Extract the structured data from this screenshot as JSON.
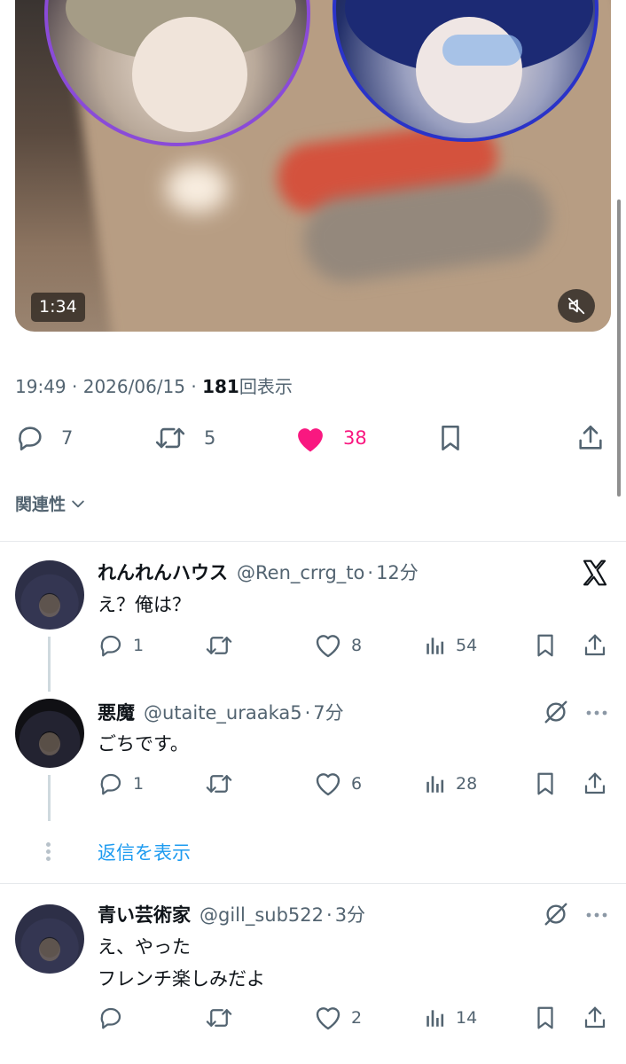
{
  "video": {
    "timecode": "1:34",
    "mute_icon": "sound-off-icon"
  },
  "post": {
    "time": "19:49",
    "separator1": " · ",
    "date": "2026/06/15",
    "separator2": " · ",
    "views_count": "181",
    "views_label": "回表示"
  },
  "post_actions": {
    "replies": "7",
    "reposts": "5",
    "likes": "38",
    "like_color": "#f91880"
  },
  "sort": {
    "label": "関連性"
  },
  "replies": [
    {
      "name": "れんれんハウス",
      "handle": "@Ren_crrg_to",
      "dot": "·",
      "time": "12分",
      "text_lines": [
        "え？俺は？"
      ],
      "reply_count": "1",
      "repost_count": "",
      "like_count": "8",
      "view_count": "54",
      "corner_icon": "x-logo-icon"
    },
    {
      "name": "悪魔",
      "handle": "@utaite_uraaka5",
      "dot": "·",
      "time": "7分",
      "text_lines": [
        "ごちです。"
      ],
      "reply_count": "1",
      "repost_count": "",
      "like_count": "6",
      "view_count": "28",
      "corner_icon": "grok-icon"
    },
    {
      "name": "青い芸術家",
      "handle": "@gill_sub522",
      "dot": "·",
      "time": "3分",
      "text_lines": [
        "え、やった",
        "フレンチ楽しみだよ"
      ],
      "reply_count": "",
      "repost_count": "",
      "like_count": "2",
      "view_count": "14",
      "corner_icon": "grok-icon"
    }
  ],
  "show_replies": "返信を表示",
  "colors": {
    "link": "#1d9bf0",
    "muted": "#536471",
    "text": "#0f1419"
  }
}
